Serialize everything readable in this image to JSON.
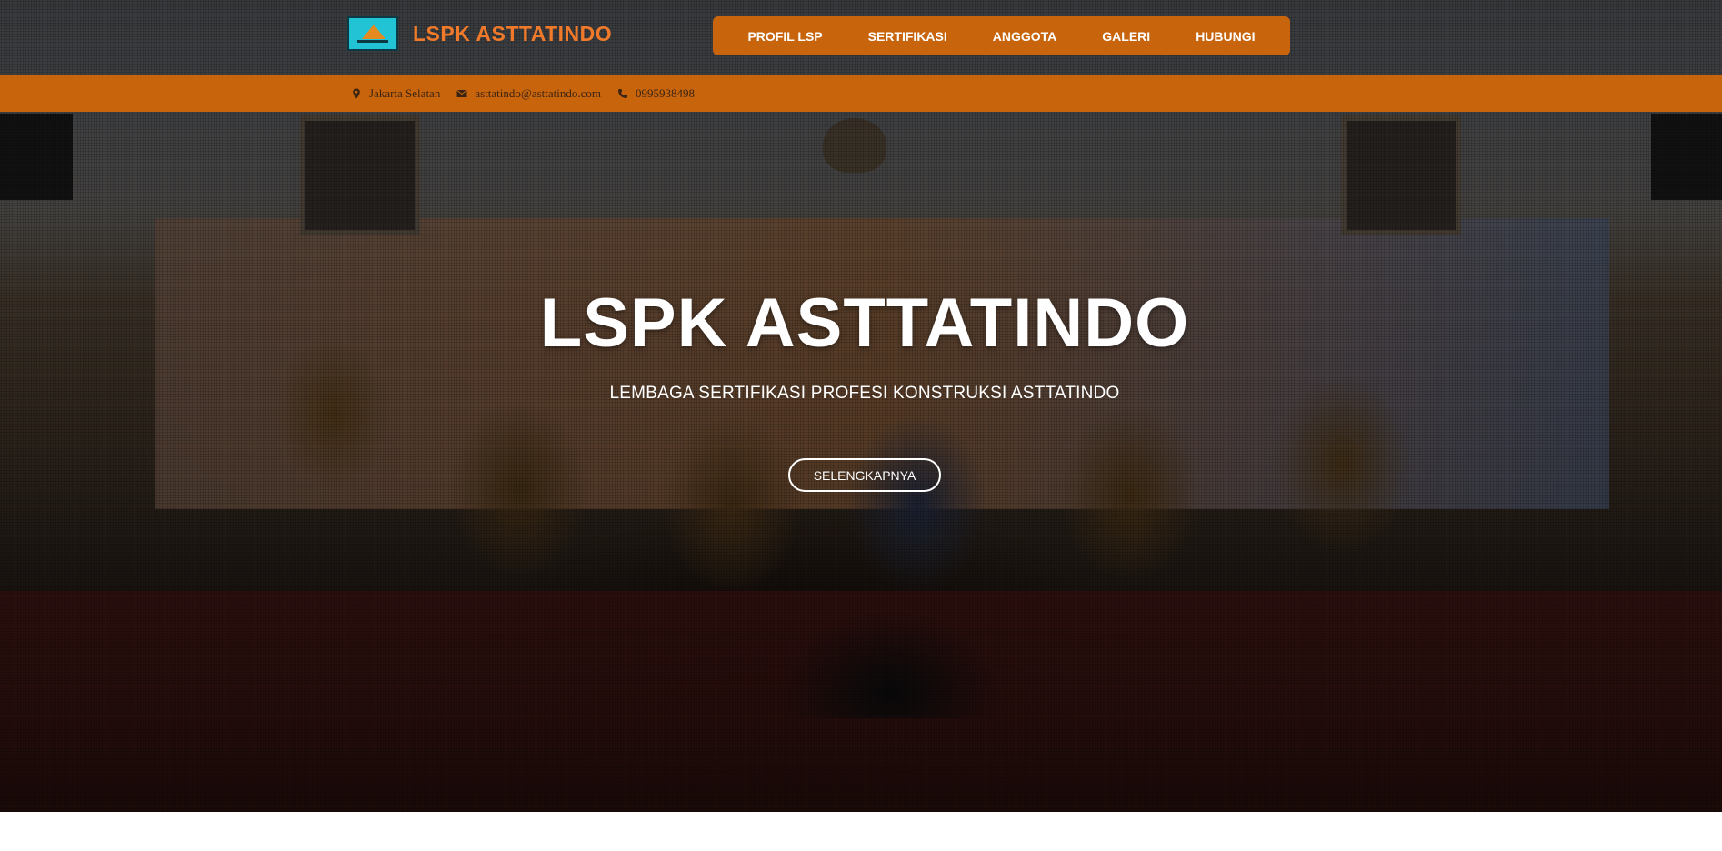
{
  "brand": {
    "name": "LSPK ASTTATINDO",
    "logo_icon": "construction-logo-icon",
    "name_color": "#f07a2a"
  },
  "nav": {
    "items": [
      {
        "label": "PROFIL LSP"
      },
      {
        "label": "SERTIFIKASI"
      },
      {
        "label": "ANGGOTA"
      },
      {
        "label": "GALERI"
      },
      {
        "label": "HUBUNGI"
      }
    ],
    "background": "#c8650c"
  },
  "contact": {
    "location": {
      "icon": "map-marker-icon",
      "text": "Jakarta Selatan"
    },
    "email": {
      "icon": "envelope-icon",
      "text": "asttatindo@asttatindo.com"
    },
    "phone": {
      "icon": "phone-icon",
      "text": "0995938498"
    },
    "bar_color": "#c8650c"
  },
  "hero": {
    "title": "LSPK ASTTATINDO",
    "subtitle": "LEMBAGA SERTIFIKASI PROFESI KONSTRUKSI ASTTATINDO",
    "button_label": "SELENGKAPNYA"
  }
}
